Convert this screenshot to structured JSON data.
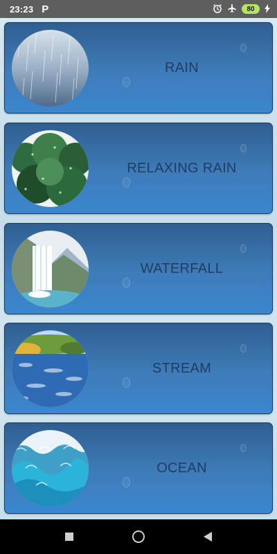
{
  "status_bar": {
    "time": "23:23",
    "app_icon": "P",
    "alarm_icon": "alarm-clock-icon",
    "airplane_icon": "airplane-mode-icon",
    "battery_level": "80",
    "charging_icon": "lightning-icon"
  },
  "sounds": [
    {
      "label": "RAIN",
      "thumbnail_icon": "rain-thumbnail"
    },
    {
      "label": "RELAXING RAIN",
      "thumbnail_icon": "relaxing-rain-thumbnail"
    },
    {
      "label": "WATERFALL",
      "thumbnail_icon": "waterfall-thumbnail"
    },
    {
      "label": "STREAM",
      "thumbnail_icon": "stream-thumbnail"
    },
    {
      "label": "OCEAN",
      "thumbnail_icon": "ocean-thumbnail"
    }
  ],
  "nav_bar": {
    "recents_icon": "recents-square-icon",
    "home_icon": "home-circle-icon",
    "back_icon": "back-triangle-icon"
  },
  "colors": {
    "card_gradient_top": "#2f5f91",
    "card_gradient_bottom": "#3b86cf",
    "label_text": "#1e3d63",
    "battery": "#b7e26a"
  }
}
